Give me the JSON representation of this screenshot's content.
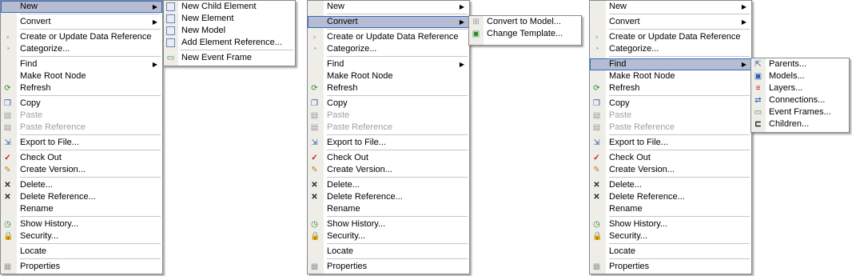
{
  "context_menu": {
    "items": [
      {
        "label": "New",
        "submenu": true
      },
      {
        "label": "Convert",
        "submenu": true
      },
      {
        "label": "Create or Update Data Reference"
      },
      {
        "label": "Categorize..."
      },
      {
        "label": "Find",
        "submenu": true
      },
      {
        "label": "Make Root Node"
      },
      {
        "label": "Refresh"
      },
      {
        "label": "Copy"
      },
      {
        "label": "Paste",
        "disabled": true
      },
      {
        "label": "Paste Reference",
        "disabled": true
      },
      {
        "label": "Export to File..."
      },
      {
        "label": "Check Out"
      },
      {
        "label": "Create Version..."
      },
      {
        "label": "Delete..."
      },
      {
        "label": "Delete Reference..."
      },
      {
        "label": "Rename"
      },
      {
        "label": "Show History..."
      },
      {
        "label": "Security..."
      },
      {
        "label": "Locate"
      },
      {
        "label": "Properties"
      }
    ]
  },
  "new_submenu": {
    "items": [
      "New Child Element",
      "New Element",
      "New Model",
      "Add Element Reference...",
      "New Event Frame"
    ]
  },
  "convert_submenu": {
    "items": [
      "Convert to Model...",
      "Change Template..."
    ]
  },
  "find_submenu": {
    "items": [
      "Parents...",
      "Models...",
      "Layers...",
      "Connections...",
      "Event Frames...",
      "Children..."
    ]
  },
  "colors": {
    "highlight": "#b6bdd2",
    "highlight_border": "#316ac5",
    "gutter": "#eeede8",
    "disabled_text": "#a0a0a0"
  }
}
